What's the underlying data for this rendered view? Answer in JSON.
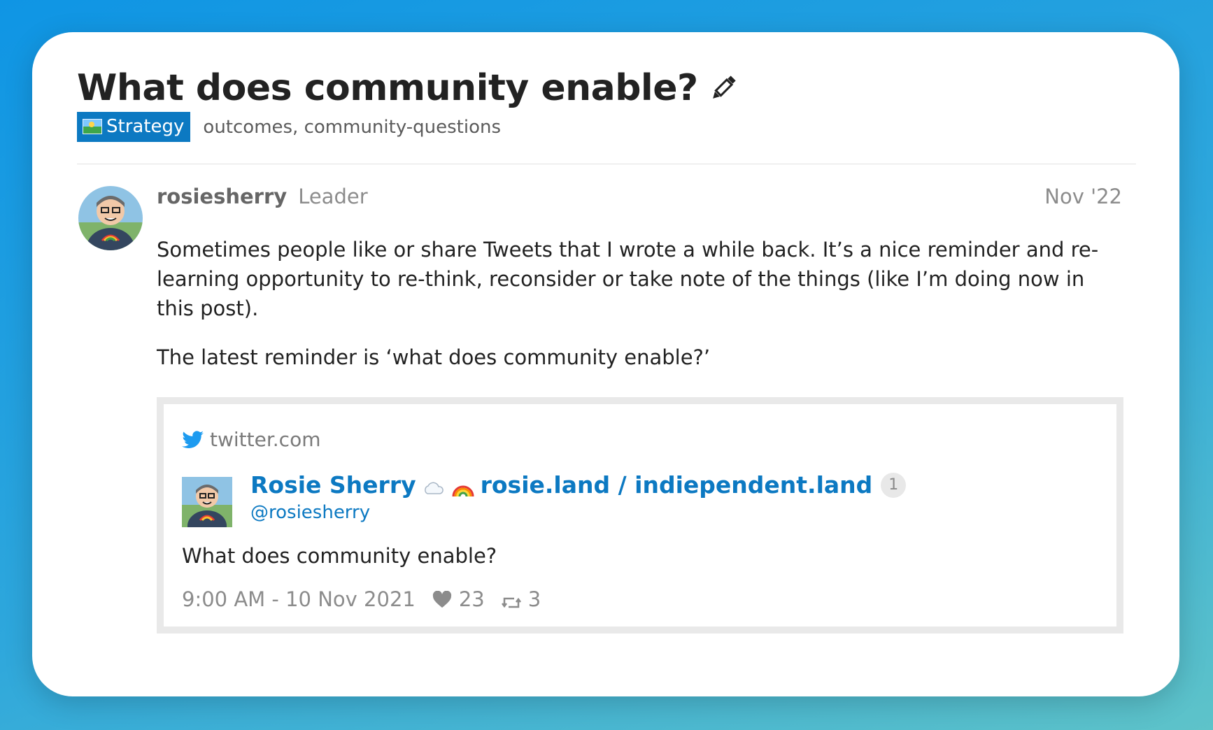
{
  "topic": {
    "title": "What does community enable?",
    "category": "Strategy",
    "tags": "outcomes, community-questions"
  },
  "post": {
    "username": "rosiesherry",
    "role": "Leader",
    "date": "Nov '22",
    "paragraphs": [
      "Sometimes people like or share Tweets that I wrote a while back. It’s a nice reminder and re-learning opportunity to re-think, reconsider or take note of the things (like I’m doing now in this post).",
      "The latest reminder is ‘what does community enable?’"
    ]
  },
  "onebox": {
    "source": "twitter.com",
    "tweet": {
      "author_name": "Rosie Sherry",
      "author_extra": "rosie.land / indiependent.land",
      "badge_count": "1",
      "handle": "@rosiesherry",
      "text": "What does community enable?",
      "timestamp": "9:00 AM - 10 Nov 2021",
      "likes": "23",
      "retweets": "3"
    }
  },
  "colors": {
    "accent": "#0c79c2",
    "background_gradient_start": "#0f95e4",
    "background_gradient_end": "#5ec3c9"
  },
  "icons": {
    "edit": "pencil-icon",
    "category": "map-icon",
    "source": "twitter-bird-icon",
    "emoji_1": "cloud-icon",
    "emoji_2": "rainbow-icon",
    "likes": "heart-icon",
    "retweets": "retweet-icon"
  }
}
